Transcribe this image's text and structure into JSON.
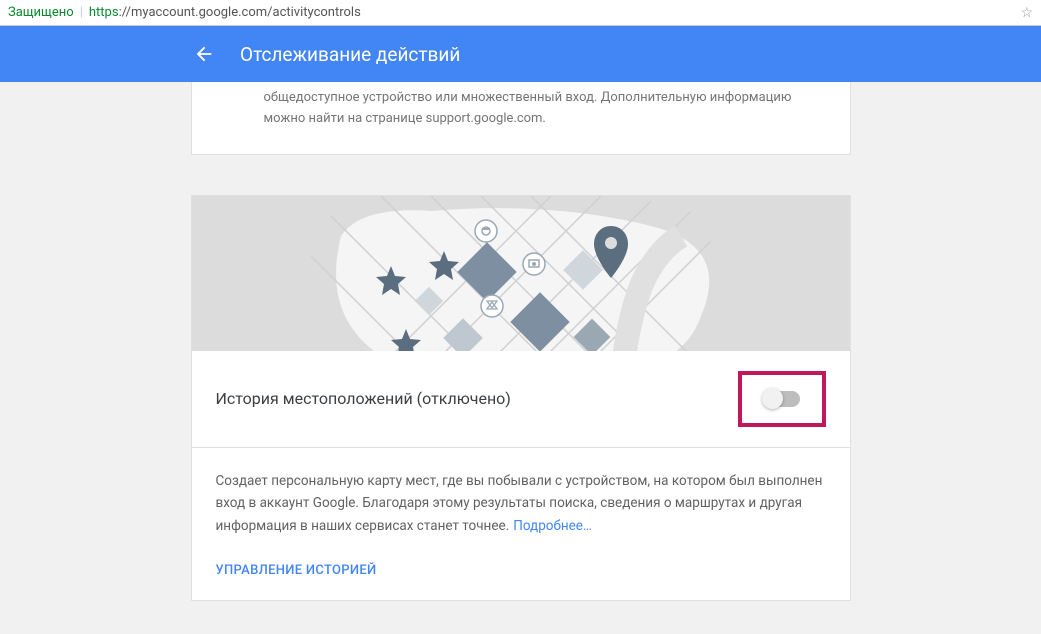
{
  "addressBar": {
    "secure": "Защищено",
    "urlProtocol": "https",
    "urlRest": "://myaccount.google.com/activitycontrols"
  },
  "header": {
    "title": "Отслеживание действий"
  },
  "topCard": {
    "text": "общедоступное устройство или множественный вход. Дополнительную информацию можно найти на странице support.google.com."
  },
  "locationCard": {
    "title": "История местоположений (отключено)",
    "description": "Создает персональную карту мест, где вы побывали с устройством, на котором был выполнен вход в аккаунт Google. Благодаря этому результаты поиска, сведения о маршрутах и другая информация в наших сервисах станет точнее.",
    "learnMore": "Подробнее…",
    "manage": "УПРАВЛЕНИЕ ИСТОРИЕЙ"
  }
}
